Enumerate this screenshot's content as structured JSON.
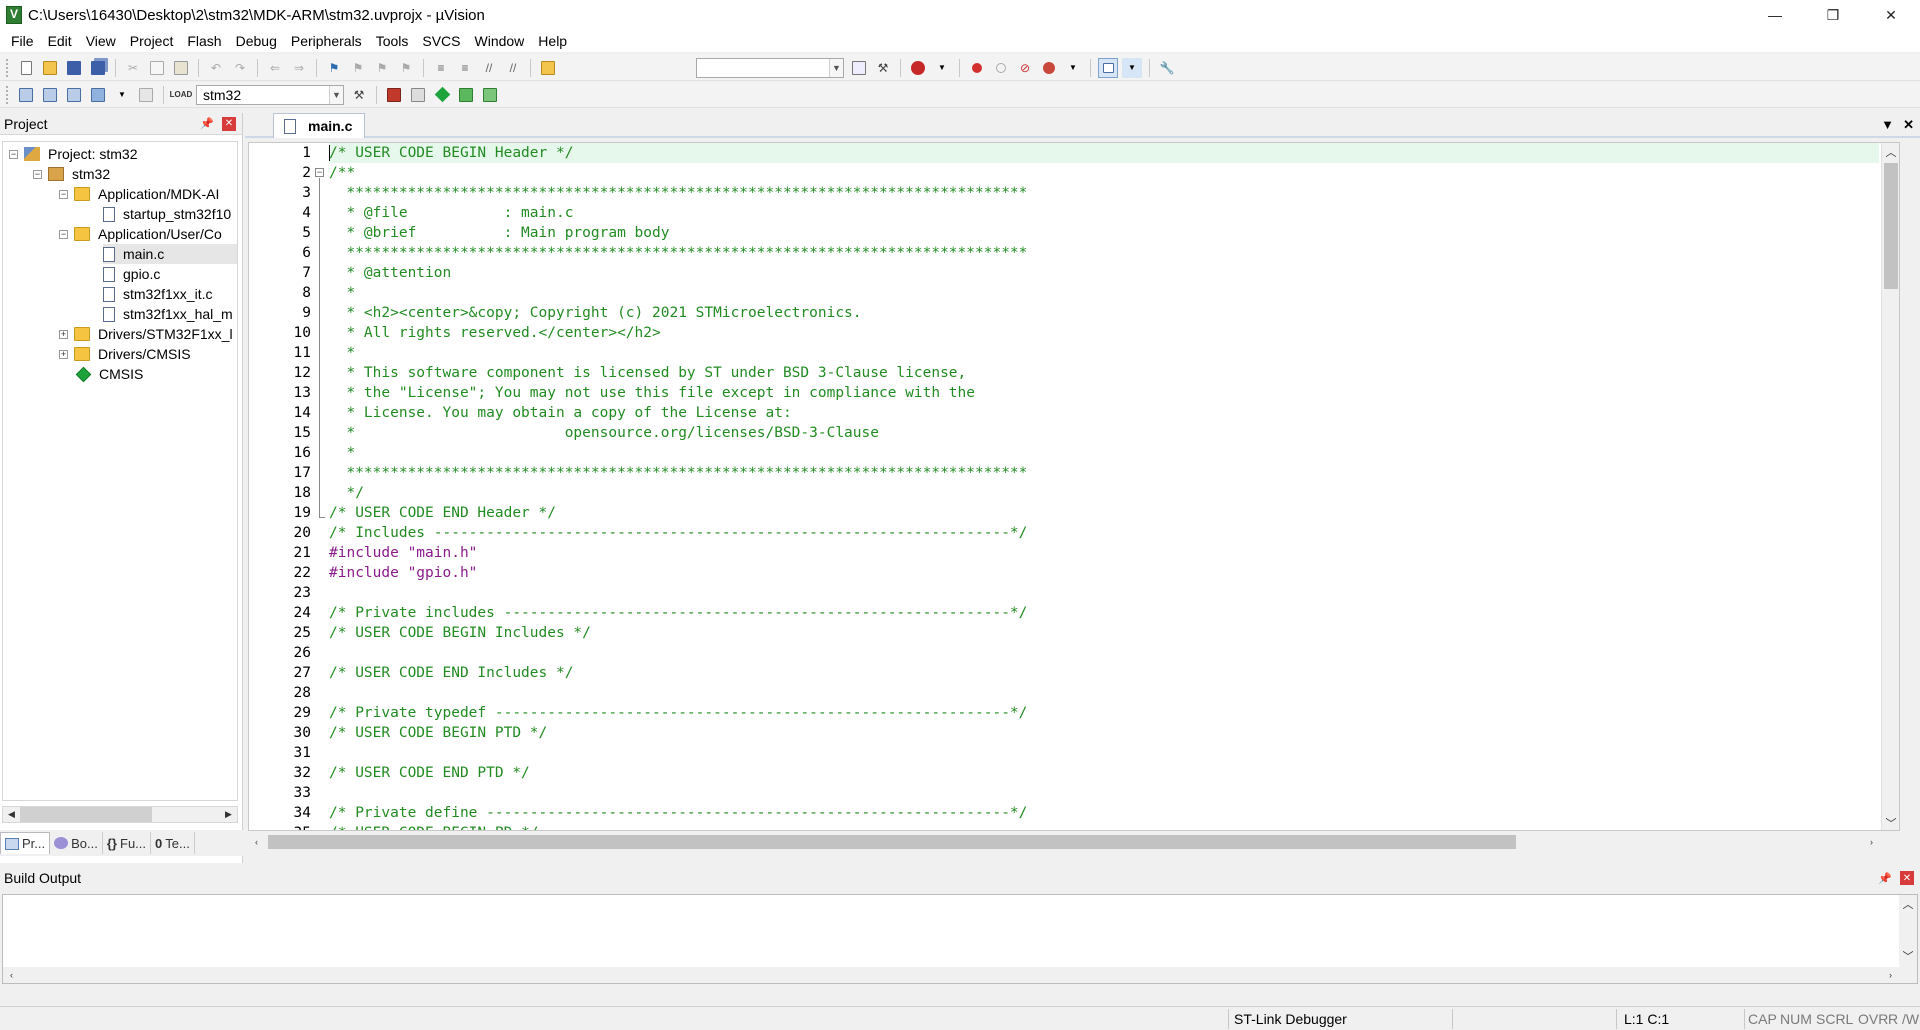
{
  "window": {
    "title": "C:\\Users\\16430\\Desktop\\2\\stm32\\MDK-ARM\\stm32.uvprojx - µVision",
    "controls": {
      "minimize": "—",
      "restore": "❐",
      "close": "✕"
    }
  },
  "menu": {
    "items": [
      {
        "label": "File"
      },
      {
        "label": "Edit"
      },
      {
        "label": "View"
      },
      {
        "label": "Project"
      },
      {
        "label": "Flash"
      },
      {
        "label": "Debug"
      },
      {
        "label": "Peripherals"
      },
      {
        "label": "Tools"
      },
      {
        "label": "SVCS"
      },
      {
        "label": "Window"
      },
      {
        "label": "Help"
      }
    ]
  },
  "toolbar2": {
    "target": "stm32"
  },
  "project_panel": {
    "title": "Project",
    "tree": [
      {
        "label": "Project: stm32"
      },
      {
        "label": "stm32"
      },
      {
        "label": "Application/MDK-AI"
      },
      {
        "label": "startup_stm32f10"
      },
      {
        "label": "Application/User/Co"
      },
      {
        "label": "main.c"
      },
      {
        "label": "gpio.c"
      },
      {
        "label": "stm32f1xx_it.c"
      },
      {
        "label": "stm32f1xx_hal_m"
      },
      {
        "label": "Drivers/STM32F1xx_l"
      },
      {
        "label": "Drivers/CMSIS"
      },
      {
        "label": "CMSIS"
      }
    ],
    "tabs": [
      {
        "label": "Pr..."
      },
      {
        "label": "Bo..."
      },
      {
        "label": "Fu..."
      },
      {
        "label": "Te..."
      }
    ]
  },
  "editor": {
    "tab": "main.c",
    "lines": [
      {
        "n": "1",
        "text": "/* USER CODE BEGIN Header */"
      },
      {
        "n": "2",
        "text": "/**"
      },
      {
        "n": "3",
        "text": "  ******************************************************************************"
      },
      {
        "n": "4",
        "text": "  * @file           : main.c"
      },
      {
        "n": "5",
        "text": "  * @brief          : Main program body"
      },
      {
        "n": "6",
        "text": "  ******************************************************************************"
      },
      {
        "n": "7",
        "text": "  * @attention"
      },
      {
        "n": "8",
        "text": "  *"
      },
      {
        "n": "9",
        "text": "  * <h2><center>&copy; Copyright (c) 2021 STMicroelectronics."
      },
      {
        "n": "10",
        "text": "  * All rights reserved.</center></h2>"
      },
      {
        "n": "11",
        "text": "  *"
      },
      {
        "n": "12",
        "text": "  * This software component is licensed by ST under BSD 3-Clause license,"
      },
      {
        "n": "13",
        "text": "  * the \"License\"; You may not use this file except in compliance with the"
      },
      {
        "n": "14",
        "text": "  * License. You may obtain a copy of the License at:"
      },
      {
        "n": "15",
        "text": "  *                        opensource.org/licenses/BSD-3-Clause"
      },
      {
        "n": "16",
        "text": "  *"
      },
      {
        "n": "17",
        "text": "  ******************************************************************************"
      },
      {
        "n": "18",
        "text": "  */"
      },
      {
        "n": "19",
        "text": "/* USER CODE END Header */"
      },
      {
        "n": "20",
        "text": "/* Includes ------------------------------------------------------------------*/"
      },
      {
        "n": "21",
        "pre": "#include ",
        "str": "\"main.h\""
      },
      {
        "n": "22",
        "pre": "#include ",
        "str": "\"gpio.h\""
      },
      {
        "n": "23",
        "text": ""
      },
      {
        "n": "24",
        "text": "/* Private includes ----------------------------------------------------------*/"
      },
      {
        "n": "25",
        "text": "/* USER CODE BEGIN Includes */"
      },
      {
        "n": "26",
        "text": ""
      },
      {
        "n": "27",
        "text": "/* USER CODE END Includes */"
      },
      {
        "n": "28",
        "text": ""
      },
      {
        "n": "29",
        "text": "/* Private typedef -----------------------------------------------------------*/"
      },
      {
        "n": "30",
        "text": "/* USER CODE BEGIN PTD */"
      },
      {
        "n": "31",
        "text": ""
      },
      {
        "n": "32",
        "text": "/* USER CODE END PTD */"
      },
      {
        "n": "33",
        "text": ""
      },
      {
        "n": "34",
        "text": "/* Private define ------------------------------------------------------------*/"
      },
      {
        "n": "35",
        "text": "/* USER CODE BEGIN PD */"
      }
    ]
  },
  "build_output": {
    "title": "Build Output"
  },
  "statusbar": {
    "debugger": "ST-Link Debugger",
    "position": "L:1 C:1",
    "flags": [
      "CAP",
      "NUM",
      "SCRL",
      "OVR",
      "R /W"
    ]
  }
}
